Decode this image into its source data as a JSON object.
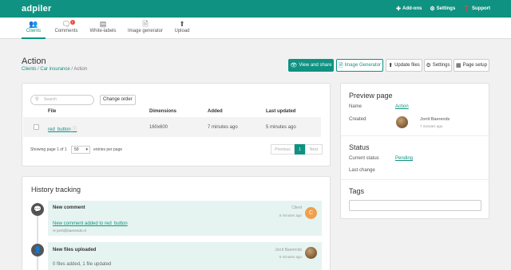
{
  "app": {
    "logo": "adpiler"
  },
  "topnav": [
    {
      "icon": "puzzle-icon",
      "label": "Add-ons"
    },
    {
      "icon": "gear-icon",
      "label": "Settings"
    },
    {
      "icon": "help-icon",
      "label": "Support"
    }
  ],
  "tabs": [
    {
      "icon": "users-icon",
      "label": "Clients",
      "active": true
    },
    {
      "icon": "comment-icon",
      "label": "Comments",
      "badge": "1"
    },
    {
      "icon": "label-icon",
      "label": "White-labels"
    },
    {
      "icon": "file-icon",
      "label": "Image generator"
    },
    {
      "icon": "upload-icon",
      "label": "Upload"
    }
  ],
  "page": {
    "title": "Action",
    "breadcrumb": {
      "clients": "Clients",
      "sep1": "/",
      "car": "Car insurance",
      "sep2": "/",
      "current": "Action"
    }
  },
  "actions": {
    "view_share": "View and share",
    "image_generator": "Image Generator",
    "update_files": "Update files",
    "settings": "Settings",
    "page_setup": "Page setup"
  },
  "table": {
    "search_placeholder": "Search",
    "change_order": "Change order",
    "headers": [
      "File",
      "Dimensions",
      "Added",
      "Last updated"
    ],
    "row": {
      "file": "red_button",
      "dimensions": "160x600",
      "added": "7 minutes ago",
      "updated": "5 minutes ago"
    },
    "showing": "Showing page 1 of 1",
    "per_page": "50",
    "entries": "entries per page",
    "prev": "Previous",
    "page": "1",
    "next": "Next"
  },
  "preview": {
    "title": "Preview page",
    "name_label": "Name",
    "name_value": "Action",
    "created_label": "Created",
    "creator": "Jorrit Baerends",
    "created_time": "7 minutes ago"
  },
  "status": {
    "title": "Status",
    "current_label": "Current status",
    "current_value": "Pending",
    "last_change_label": "Last change"
  },
  "tags": {
    "title": "Tags",
    "input_value": ""
  },
  "history": {
    "title": "History tracking",
    "items": [
      {
        "icon": "comment-icon",
        "title": "New comment",
        "user": "Client",
        "time": "5 minutes ago",
        "link": "New comment added to red_button",
        "email": "jorrit@baerends.nl",
        "avatar_letter": "C"
      },
      {
        "icon": "user-icon",
        "title": "New files uploaded",
        "user": "Jorrit Baerends",
        "time": "5 minutes ago",
        "detail": "0 files added, 1 file updated"
      }
    ]
  },
  "colors": {
    "brand": "#0f9281",
    "page_bg": "#f1f1f1",
    "history_bg": "#e6f4f1",
    "badge": "#e74c3c"
  }
}
